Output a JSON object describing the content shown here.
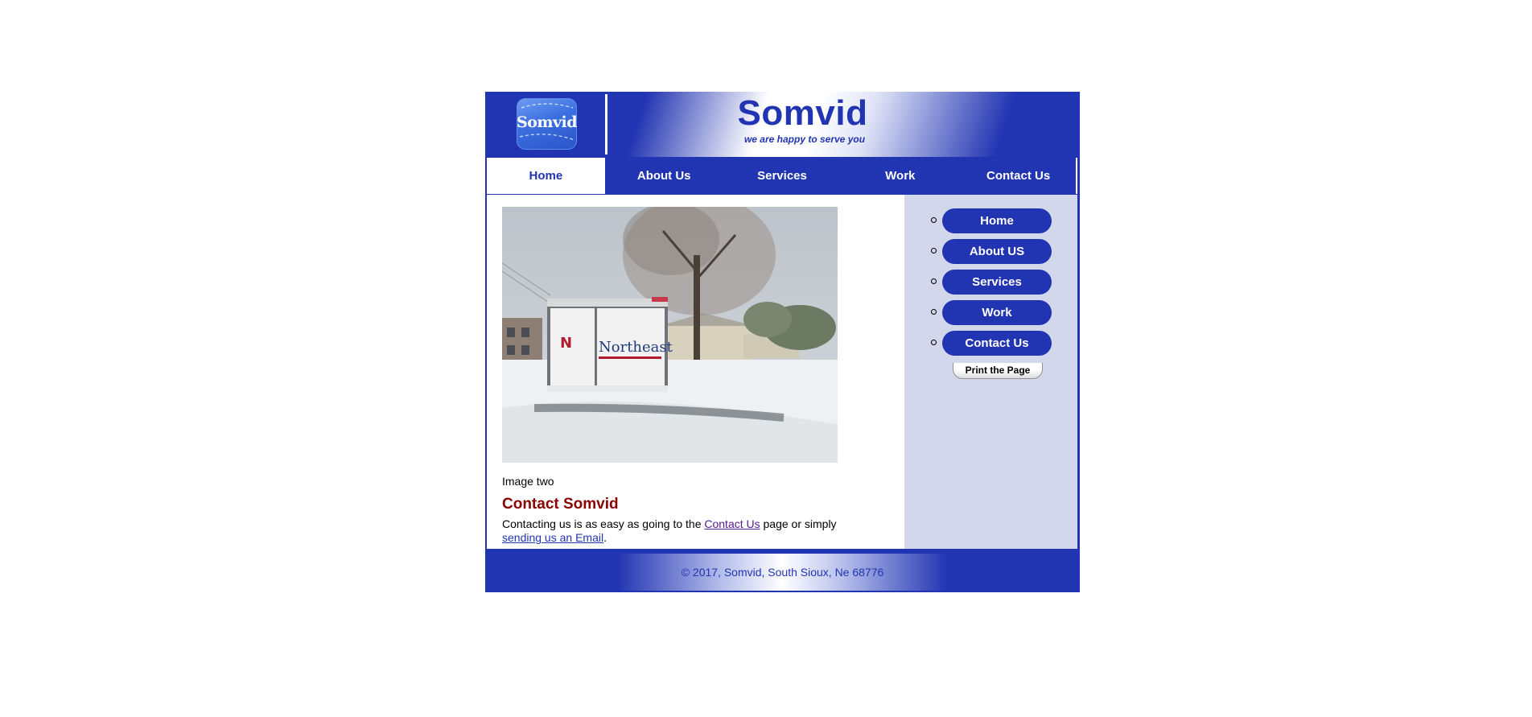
{
  "site": {
    "logo_text": "Somvid",
    "title": "Somvid",
    "tagline": "we are happy to serve you"
  },
  "nav": {
    "items": [
      {
        "label": "Home",
        "active": true
      },
      {
        "label": "About Us",
        "active": false
      },
      {
        "label": "Services",
        "active": false
      },
      {
        "label": "Work",
        "active": false
      },
      {
        "label": "Contact Us",
        "active": false
      }
    ]
  },
  "content": {
    "image_caption": "Image two",
    "heading": "Contact Somvid",
    "text_before": "Contacting us is as easy as going to the ",
    "contact_link": "Contact Us",
    "text_middle": " page or simply ",
    "email_link": "sending us an Email",
    "text_after": "."
  },
  "sidebar": {
    "items": [
      "Home",
      "About US",
      "Services",
      "Work",
      "Contact Us"
    ],
    "print_label": "Print the Page"
  },
  "footer": {
    "text": "© 2017, Somvid, South Sioux, Ne 68776"
  },
  "colors": {
    "primary": "#2134b1",
    "sidebar_bg": "#d2d7eb",
    "heading": "#8b0000"
  }
}
